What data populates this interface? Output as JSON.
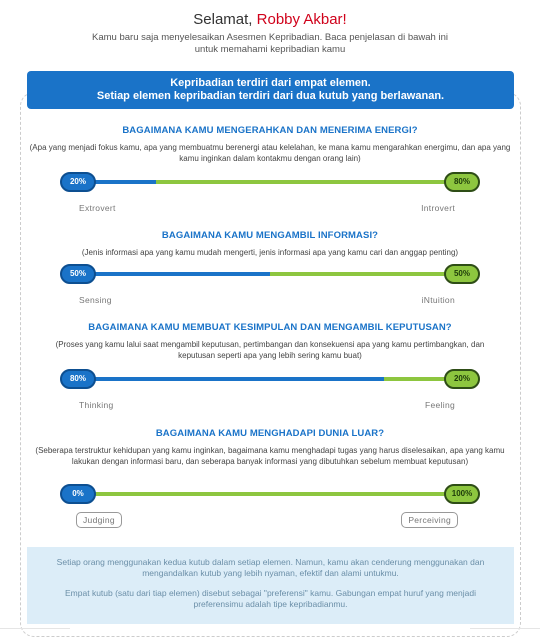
{
  "header": {
    "greeting_prefix": "Selamat,",
    "user_name": "Robby Akbar!",
    "intro": "Kamu baru saja menyelesaikan Asesmen Kepribadian. Baca penjelasan di bawah ini untuk memahami kepribadian kamu"
  },
  "banner": {
    "line1": "Kepribadian terdiri dari empat elemen.",
    "line2": "Setiap elemen kepribadian terdiri dari dua kutub yang berlawanan."
  },
  "sections": [
    {
      "title": "BAGAIMANA KAMU MENGERAHKAN DAN MENERIMA ENERGI?",
      "desc": "(Apa yang menjadi fokus kamu, apa yang membuatmu berenergi atau kelelahan, ke mana kamu mengarahkan energimu, dan apa yang kamu inginkan dalam kontakmu dengan orang lain)",
      "left_pct": "20%",
      "right_pct": "80%",
      "left_value": 20,
      "left_label": "Extrovert",
      "right_label": "Introvert"
    },
    {
      "title": "BAGAIMANA KAMU MENGAMBIL INFORMASI?",
      "desc": "(Jenis informasi apa yang kamu mudah mengerti, jenis informasi apa yang kamu cari dan anggap penting)",
      "left_pct": "50%",
      "right_pct": "50%",
      "left_value": 50,
      "left_label": "Sensing",
      "right_label": "iNtuition"
    },
    {
      "title": "BAGAIMANA KAMU MEMBUAT KESIMPULAN DAN MENGAMBIL KEPUTUSAN?",
      "desc": "(Proses yang kamu lalui saat mengambil keputusan, pertimbangan dan konsekuensi apa yang kamu pertimbangkan, dan keputusan seperti apa yang lebih sering kamu buat)",
      "left_pct": "80%",
      "right_pct": "20%",
      "left_value": 80,
      "left_label": "Thinking",
      "right_label": "Feeling"
    },
    {
      "title": "BAGAIMANA KAMU MENGHADAPI DUNIA LUAR?",
      "desc": "(Seberapa terstruktur kehidupan yang kamu inginkan, bagaimana kamu menghadapi tugas yang harus diselesaikan, apa yang kamu lakukan dengan informasi baru, dan seberapa banyak informasi yang dibutuhkan sebelum membuat keputusan)",
      "left_pct": "0%",
      "right_pct": "100%",
      "left_value": 0,
      "left_label": "Judging",
      "right_label": "Perceiving"
    }
  ],
  "info": {
    "p1": "Setiap orang menggunakan kedua kutub dalam setiap elemen. Namun, kamu akan cenderung menggunakan dan mengandalkan kutub yang lebih nyaman, efektif dan alami untukmu.",
    "p2": "Empat kutub (satu dari tiap elemen) disebut sebagai \"preferensi\" kamu. Gabungan empat huruf yang menjadi preferensimu adalah tipe kepribadianmu."
  },
  "colors": {
    "accent_blue": "#1a73c8",
    "accent_green": "#8dc63f",
    "name_red": "#d0021b",
    "info_bg": "#dcedf8"
  }
}
